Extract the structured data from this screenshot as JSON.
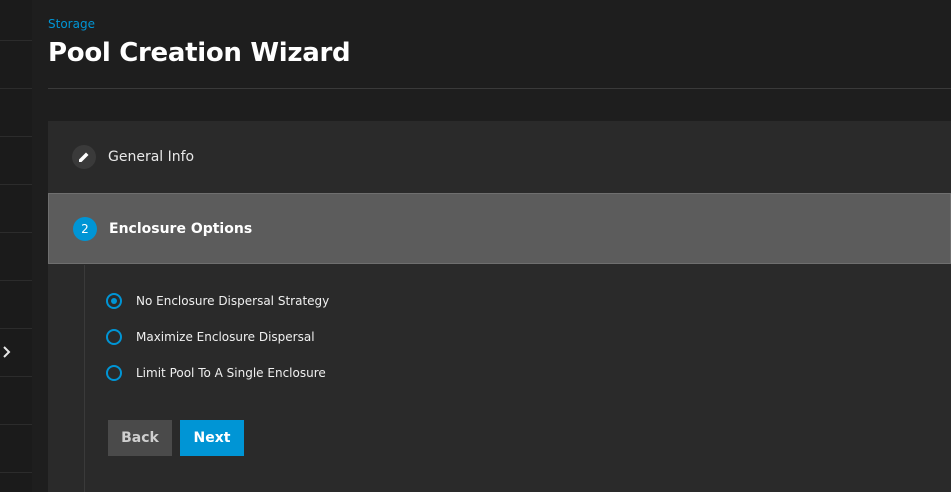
{
  "breadcrumb": "Storage",
  "title": "Pool Creation Wizard",
  "steps": [
    {
      "label": "General Info",
      "icon": "pencil-icon",
      "state": "done"
    },
    {
      "label": "Enclosure Options",
      "number": "2",
      "state": "active"
    }
  ],
  "enclosure_options": [
    {
      "label": "No Enclosure Dispersal Strategy",
      "checked": true
    },
    {
      "label": "Maximize Enclosure Dispersal",
      "checked": false
    },
    {
      "label": "Limit Pool To A Single Enclosure",
      "checked": false
    }
  ],
  "buttons": {
    "back": "Back",
    "next": "Next"
  },
  "colors": {
    "accent": "#0095d5",
    "background": "#1e1e1e",
    "card": "#2a2a2a",
    "active_step": "#5c5c5c"
  }
}
